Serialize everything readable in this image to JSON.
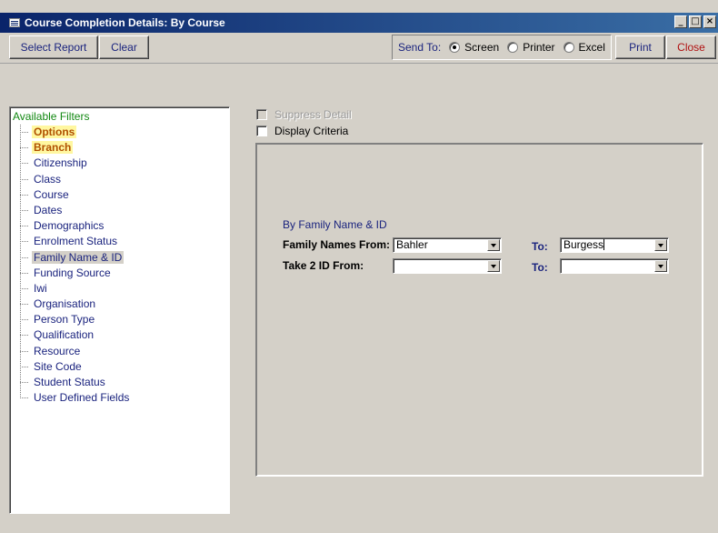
{
  "window": {
    "title": "Course Completion Details: By Course",
    "controls": [
      "minimize",
      "maximize",
      "close"
    ]
  },
  "toolbar": {
    "select_report": "Select Report",
    "clear": "Clear",
    "send_to_label": "Send To:",
    "options": [
      {
        "label": "Screen",
        "selected": true
      },
      {
        "label": "Printer",
        "selected": false
      },
      {
        "label": "Excel",
        "selected": false
      }
    ],
    "print": "Print",
    "close": "Close"
  },
  "filters": {
    "root": "Available Filters",
    "items": [
      {
        "label": "Options",
        "state": "highlighted"
      },
      {
        "label": "Branch",
        "state": "highlighted"
      },
      {
        "label": "Citizenship",
        "state": "normal"
      },
      {
        "label": "Class",
        "state": "normal"
      },
      {
        "label": "Course",
        "state": "normal"
      },
      {
        "label": "Dates",
        "state": "normal"
      },
      {
        "label": "Demographics",
        "state": "normal"
      },
      {
        "label": "Enrolment Status",
        "state": "normal"
      },
      {
        "label": "Family Name & ID",
        "state": "selected"
      },
      {
        "label": "Funding Source",
        "state": "normal"
      },
      {
        "label": "Iwi",
        "state": "normal"
      },
      {
        "label": "Organisation",
        "state": "normal"
      },
      {
        "label": "Person Type",
        "state": "normal"
      },
      {
        "label": "Qualification",
        "state": "normal"
      },
      {
        "label": "Resource",
        "state": "normal"
      },
      {
        "label": "Site Code",
        "state": "normal"
      },
      {
        "label": "Student Status",
        "state": "normal"
      },
      {
        "label": "User Defined Fields",
        "state": "normal"
      }
    ]
  },
  "options": {
    "suppress_detail": {
      "label": "Suppress Detail",
      "checked": false,
      "enabled": false
    },
    "display_criteria": {
      "label": "Display Criteria",
      "checked": false,
      "enabled": true
    }
  },
  "panel": {
    "title": "By Family Name & ID",
    "family_names_from_label": "Family Names From:",
    "family_names_from_value": "Bahler",
    "family_names_to_label": "To:",
    "family_names_to_value": "Burgess",
    "take2_from_label": "Take 2 ID From:",
    "take2_from_value": "",
    "take2_to_label": "To:",
    "take2_to_value": ""
  },
  "colors": {
    "titlebar_start": "#0a246a",
    "titlebar_end": "#3a6ea5",
    "window_bg": "#d4d0c8",
    "highlight_bg": "#fff7a0",
    "highlight_text": "#b05000",
    "link_text": "#1a237e"
  }
}
